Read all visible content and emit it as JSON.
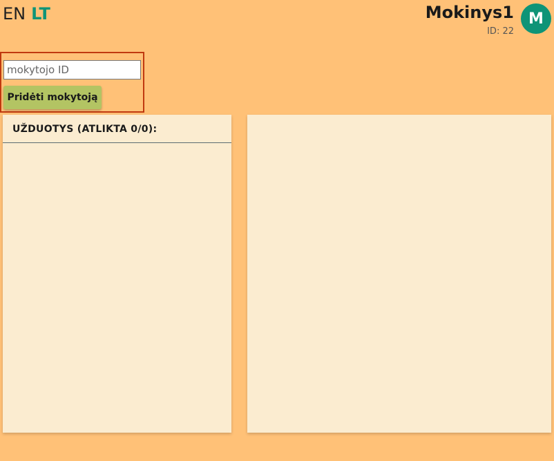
{
  "language": {
    "en_label": "EN",
    "lt_label": "LT",
    "active": "LT"
  },
  "user": {
    "name": "Mokinys1",
    "id_text": "ID: 22",
    "avatar_letter": "M"
  },
  "add_teacher": {
    "placeholder": "mokytojo ID",
    "value": "",
    "button_label": "Pridėti mokytoją"
  },
  "tasks_panel": {
    "title": "UŽDUOTYS (ATLIKTA 0/0):",
    "items": []
  },
  "colors": {
    "background": "#ffc177",
    "accent": "#0e9477",
    "panel": "#fbecd0",
    "button": "#b3c463",
    "highlight_border": "#c0390f"
  }
}
